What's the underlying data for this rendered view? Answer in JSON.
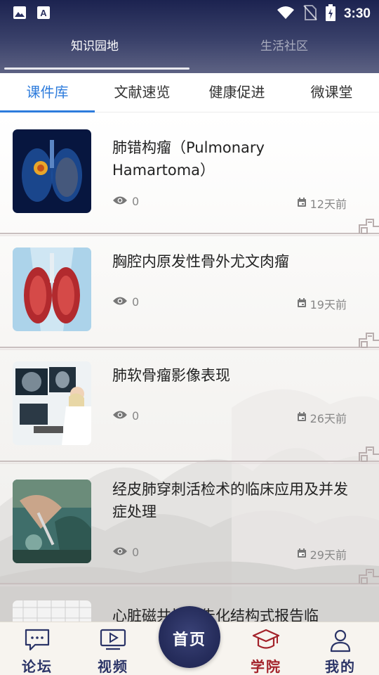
{
  "status_bar": {
    "time": "3:30",
    "left_icons": [
      "image-icon",
      "a-notification-icon"
    ],
    "right_icons": [
      "wifi-icon",
      "no-sim-icon",
      "battery-charging-icon"
    ]
  },
  "top_tabs": [
    {
      "label": "知识园地",
      "active": true
    },
    {
      "label": "生活社区",
      "active": false
    }
  ],
  "category_tabs": [
    {
      "label": "课件库",
      "active": true
    },
    {
      "label": "文献速览",
      "active": false
    },
    {
      "label": "健康促进",
      "active": false
    },
    {
      "label": "微课堂",
      "active": false
    }
  ],
  "articles": [
    {
      "title": "肺错构瘤（Pulmonary Hamartoma）",
      "views": "0",
      "date": "12天前",
      "thumb": "lung-tumor-illustration"
    },
    {
      "title": "胸腔内原发性骨外尤文肉瘤",
      "views": "0",
      "date": "19天前",
      "thumb": "lungs-illustration"
    },
    {
      "title": "肺软骨瘤影像表现",
      "views": "0",
      "date": "26天前",
      "thumb": "doctor-viewing-scans-photo"
    },
    {
      "title": "经皮肺穿刺活检术的临床应用及并发症处理",
      "views": "0",
      "date": "29天前",
      "thumb": "surgery-photo"
    },
    {
      "title": "心脏磁共振报告化结构式报告临",
      "views": "",
      "date": "",
      "thumb": "grid-illustration"
    }
  ],
  "bottom_nav": {
    "items": [
      {
        "label": "论坛",
        "icon": "chat-bubble-icon",
        "active": false
      },
      {
        "label": "视频",
        "icon": "video-icon",
        "active": false
      },
      {
        "label": "学院",
        "icon": "graduation-cap-icon",
        "active": true
      },
      {
        "label": "我的",
        "icon": "user-icon",
        "active": false
      }
    ],
    "home_label": "首页"
  },
  "colors": {
    "accent": "#2e7cdc",
    "header_dark": "#1c2350",
    "nav_ink": "#2b3467",
    "nav_active": "#a3222a"
  }
}
